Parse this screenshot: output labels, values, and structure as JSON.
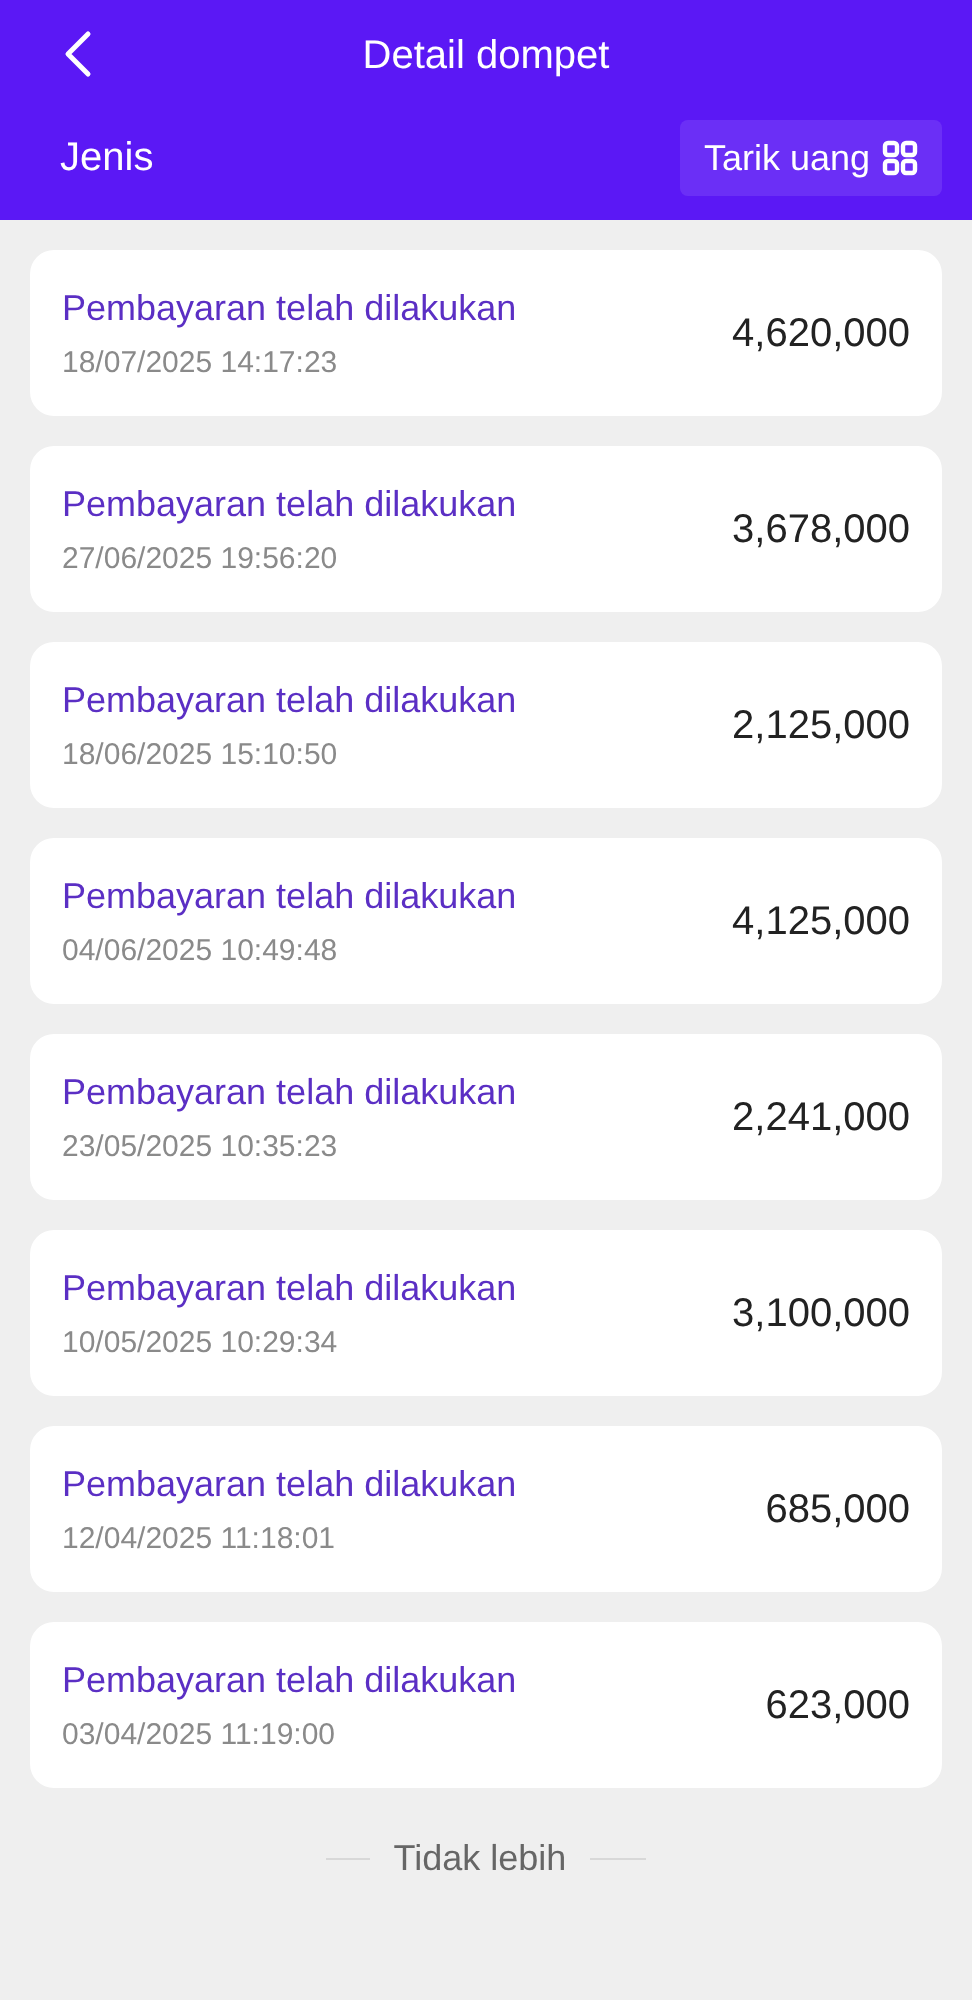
{
  "header": {
    "title": "Detail dompet",
    "filter_label": "Jenis",
    "withdraw_button": "Tarik uang"
  },
  "transactions": [
    {
      "title": "Pembayaran telah dilakukan",
      "time": "18/07/2025 14:17:23",
      "amount": "4,620,000"
    },
    {
      "title": "Pembayaran telah dilakukan",
      "time": "27/06/2025 19:56:20",
      "amount": "3,678,000"
    },
    {
      "title": "Pembayaran telah dilakukan",
      "time": "18/06/2025 15:10:50",
      "amount": "2,125,000"
    },
    {
      "title": "Pembayaran telah dilakukan",
      "time": "04/06/2025 10:49:48",
      "amount": "4,125,000"
    },
    {
      "title": "Pembayaran telah dilakukan",
      "time": "23/05/2025 10:35:23",
      "amount": "2,241,000"
    },
    {
      "title": "Pembayaran telah dilakukan",
      "time": "10/05/2025 10:29:34",
      "amount": "3,100,000"
    },
    {
      "title": "Pembayaran telah dilakukan",
      "time": "12/04/2025 11:18:01",
      "amount": "685,000"
    },
    {
      "title": "Pembayaran telah dilakukan",
      "time": "03/04/2025 11:19:00",
      "amount": "623,000"
    }
  ],
  "end_text": "Tidak lebih"
}
